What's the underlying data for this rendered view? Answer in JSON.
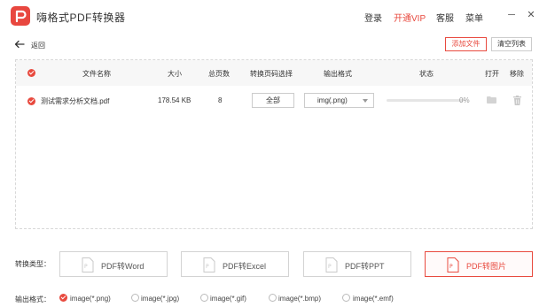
{
  "app": {
    "title": "嗨格式PDF转换器"
  },
  "topbar": {
    "login": "登录",
    "vip": "开通VIP",
    "service": "客服",
    "menu": "菜单",
    "minimize": "─",
    "close": "✕"
  },
  "subbar": {
    "back": "返回",
    "add_file": "添加文件",
    "clear_list": "清空列表"
  },
  "table": {
    "columns": [
      "文件名称",
      "大小",
      "总页数",
      "转换页码选择",
      "输出格式",
      "状态",
      "打开",
      "移除"
    ],
    "rows": [
      {
        "name": "测试需求分析文档.pdf",
        "size": "178.54 KB",
        "pages": "8",
        "page_select": "全部",
        "format": "img(.png)",
        "progress": 0,
        "status": "0%"
      }
    ]
  },
  "conversion": {
    "label": "转换类型：",
    "options": [
      "PDF转Word",
      "PDF转Excel",
      "PDF转PPT",
      "PDF转图片"
    ],
    "selected_index": 3
  },
  "output_format": {
    "label": "输出格式：",
    "options": [
      "image(*.png)",
      "image(*.jpg)",
      "image(*.gif)",
      "image(*.bmp)",
      "image(*.emf)"
    ],
    "selected_index": 0
  },
  "colors": {
    "accent": "#e84a3f",
    "border": "#d3d3d3",
    "header_bg": "#f7f7f7"
  }
}
